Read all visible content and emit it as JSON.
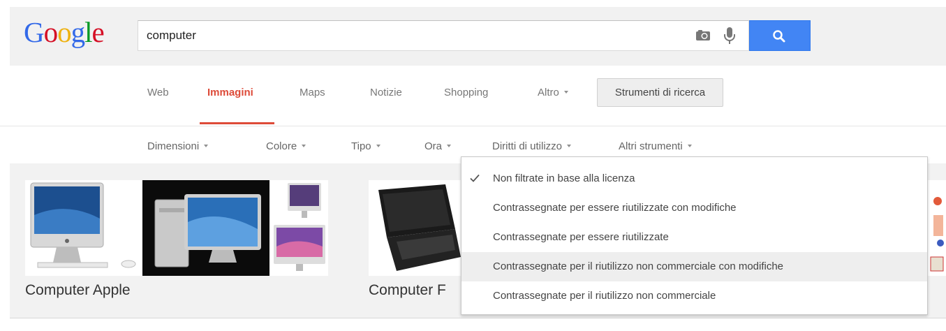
{
  "logo": {
    "letters": [
      "G",
      "o",
      "o",
      "g",
      "l",
      "e"
    ],
    "colors": [
      "#3369e8",
      "#d50f25",
      "#eeb211",
      "#3369e8",
      "#009925",
      "#d50f25"
    ]
  },
  "search": {
    "query": "computer"
  },
  "tabs": [
    {
      "label": "Web"
    },
    {
      "label": "Immagini"
    },
    {
      "label": "Maps"
    },
    {
      "label": "Notizie"
    },
    {
      "label": "Shopping"
    },
    {
      "label": "Altro"
    }
  ],
  "tools_button": "Strumenti di ricerca",
  "filters": [
    {
      "label": "Dimensioni"
    },
    {
      "label": "Colore"
    },
    {
      "label": "Tipo"
    },
    {
      "label": "Ora"
    },
    {
      "label": "Diritti di utilizzo"
    },
    {
      "label": "Altri strumenti"
    }
  ],
  "results": [
    {
      "caption": "Computer Apple"
    },
    {
      "caption": "Computer F"
    }
  ],
  "usage_rights_menu": {
    "items": [
      {
        "label": "Non filtrate in base alla licenza",
        "checked": true
      },
      {
        "label": "Contrassegnate per essere riutilizzate con modifiche"
      },
      {
        "label": "Contrassegnate per essere riutilizzate"
      },
      {
        "label": "Contrassegnate per il riutilizzo non commerciale con modifiche",
        "hovered": true
      },
      {
        "label": "Contrassegnate per il riutilizzo non commerciale"
      }
    ]
  },
  "colors": {
    "accent_red": "#dd4b39",
    "search_blue": "#4285f4"
  }
}
